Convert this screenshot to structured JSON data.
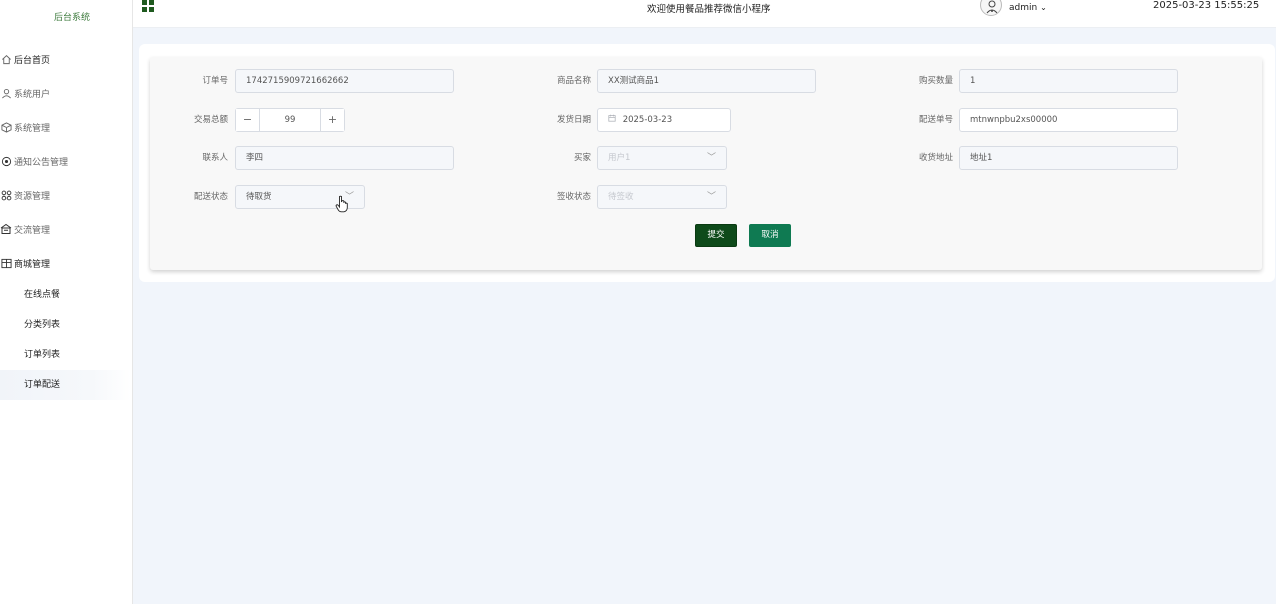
{
  "sidebar": {
    "brand": "后台系统",
    "items": [
      {
        "label": "后台首页",
        "icon": "home-icon"
      },
      {
        "label": "系统用户",
        "icon": "user-icon"
      },
      {
        "label": "系统管理",
        "icon": "cube-icon"
      },
      {
        "label": "通知公告管理",
        "icon": "target-icon"
      },
      {
        "label": "资源管理",
        "icon": "grid-icon"
      },
      {
        "label": "交流管理",
        "icon": "chat-icon"
      },
      {
        "label": "商城管理",
        "icon": "store-icon"
      }
    ],
    "sub_items": [
      {
        "label": "在线点餐"
      },
      {
        "label": "分类列表"
      },
      {
        "label": "订单列表"
      },
      {
        "label": "订单配送"
      }
    ]
  },
  "header": {
    "welcome": "欢迎使用餐品推荐微信小程序",
    "user": "admin",
    "datetime": "2025-03-23 15:55:25"
  },
  "form": {
    "order_no_label": "订单号",
    "order_no_value": "1742715909721662662",
    "product_name_label": "商品名称",
    "product_name_value": "XX测试商品1",
    "quantity_label": "购买数量",
    "quantity_value": "1",
    "total_label": "交易总额",
    "total_value": "99",
    "ship_date_label": "发货日期",
    "ship_date_value": "2025-03-23",
    "tracking_label": "配送单号",
    "tracking_value": "mtnwnpbu2xs00000",
    "contact_label": "联系人",
    "contact_value": "李四",
    "buyer_label": "买家",
    "buyer_value": "用户1",
    "address_label": "收货地址",
    "address_value": "地址1",
    "delivery_status_label": "配送状态",
    "delivery_status_value": "待取货",
    "sign_status_label": "签收状态",
    "sign_status_value": "待签收",
    "minus": "−",
    "plus": "+",
    "chev": "﹀",
    "submit": "提交",
    "cancel": "取消"
  }
}
